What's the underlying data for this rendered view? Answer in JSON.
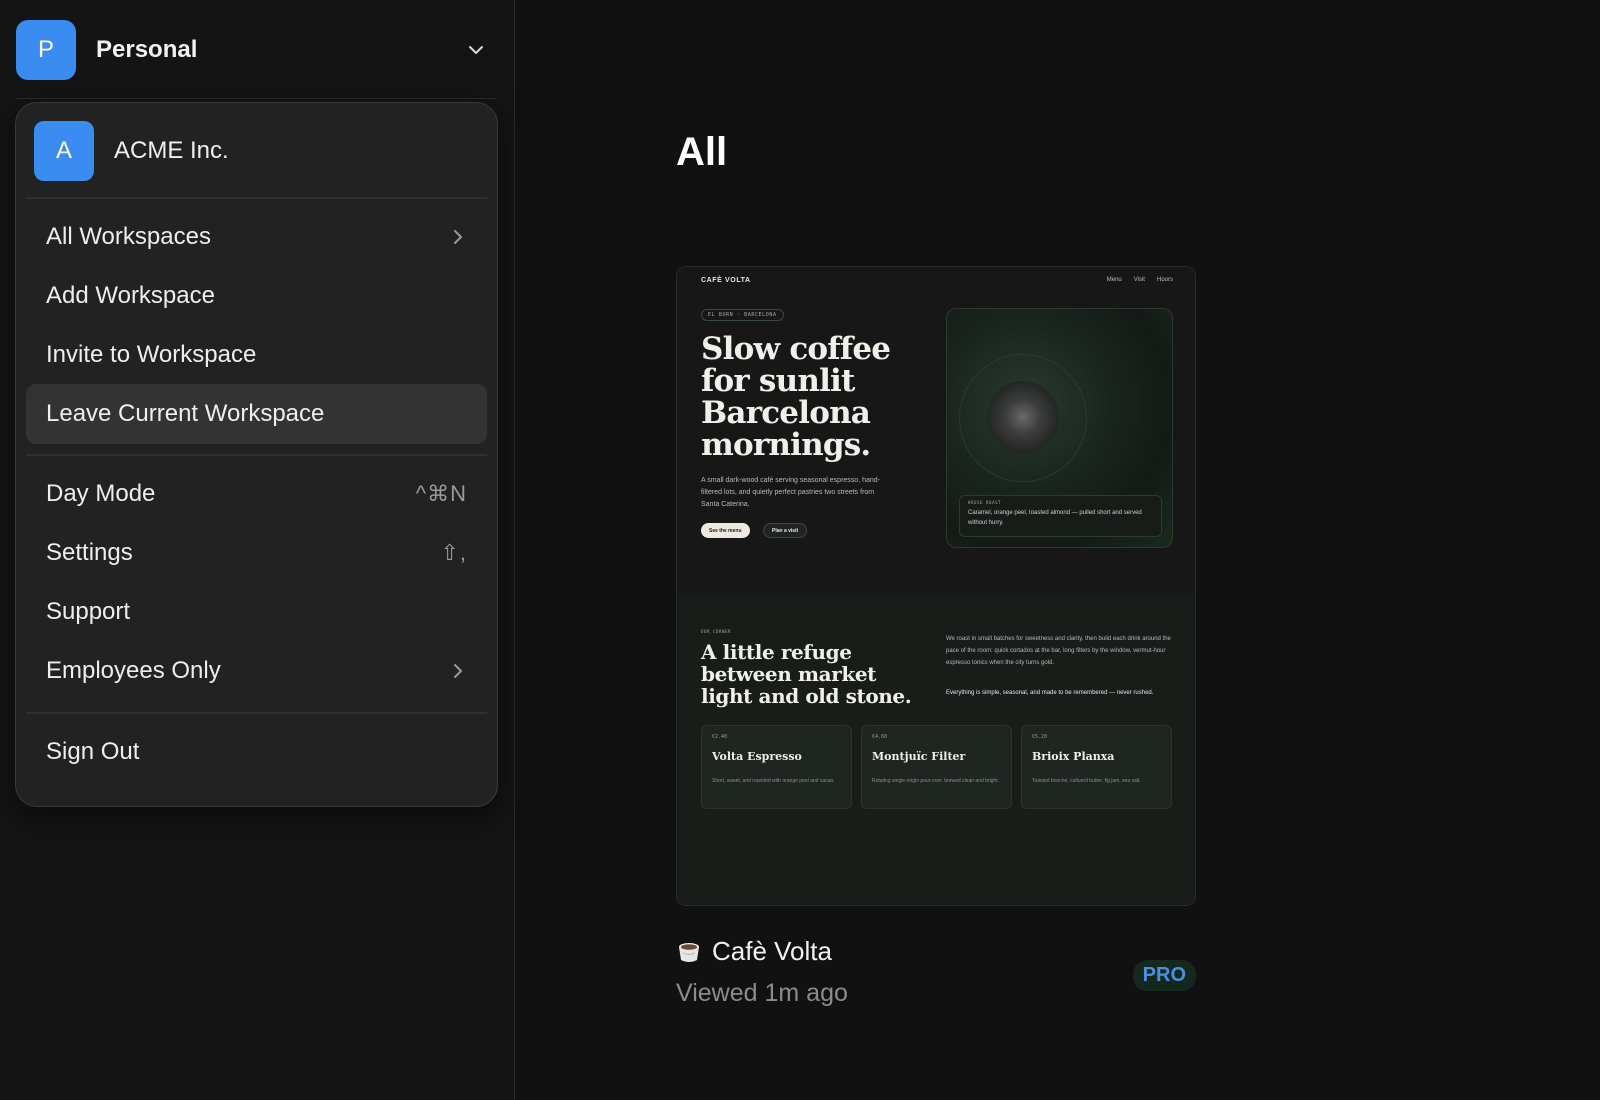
{
  "sidebar": {
    "workspace": {
      "initial": "P",
      "name": "Personal"
    },
    "menu": {
      "org": {
        "initial": "A",
        "name": "ACME Inc."
      },
      "group1": [
        {
          "label": "All Workspaces"
        },
        {
          "label": "Add Workspace"
        },
        {
          "label": "Invite to Workspace"
        },
        {
          "label": "Leave Current Workspace"
        }
      ],
      "group2": [
        {
          "label": "Day Mode",
          "shortcut": "^⌘N"
        },
        {
          "label": "Settings",
          "shortcut": "⇧,"
        },
        {
          "label": "Support"
        },
        {
          "label": "Employees Only"
        }
      ],
      "sign_out": "Sign Out"
    }
  },
  "main": {
    "title": "All",
    "card": {
      "title": "Cafè Volta",
      "subtitle": "Viewed 1m ago",
      "badge": "PRO",
      "preview": {
        "brand": "CAFÈ VOLTA",
        "nav": [
          "Menu",
          "Visit",
          "Hours"
        ],
        "pill": "EL BORN · BARCELONA",
        "hero_title": "Slow coffee for sunlit Barcelona mornings.",
        "hero_sub": "A small dark-wood café serving seasonal espresso, hand-filtered lots, and quietly perfect pastries two streets from Santa Caterina.",
        "btn_primary": "See the menu",
        "btn_secondary": "Plan a visit",
        "art_label": "HOUSE ROAST",
        "art_text": "Caramel, orange peel, toasted almond — pulled short and served without hurry.",
        "corner_label": "OUR CORNER",
        "corner_title": "A little refuge between market light and old stone.",
        "para1": "We roast in small batches for sweetness and clarity, then build each drink around the pace of the room: quick cortados at the bar, long filters by the window, vermut-hour espresso tonics when the city turns gold.",
        "para2": "Everything is simple, seasonal, and made to be remembered — never rushed.",
        "menu_cards": [
          {
            "price": "€2.40",
            "name": "Volta Espresso",
            "desc": "Short, sweet, and rounded with orange peel and cacao."
          },
          {
            "price": "€4.60",
            "name": "Montjuïc Filter",
            "desc": "Rotating single-origin pour-over, brewed clean and bright."
          },
          {
            "price": "€5.20",
            "name": "Brioix Planxa",
            "desc": "Toasted brioche, cultured butter, fig jam, sea salt."
          }
        ]
      }
    }
  }
}
